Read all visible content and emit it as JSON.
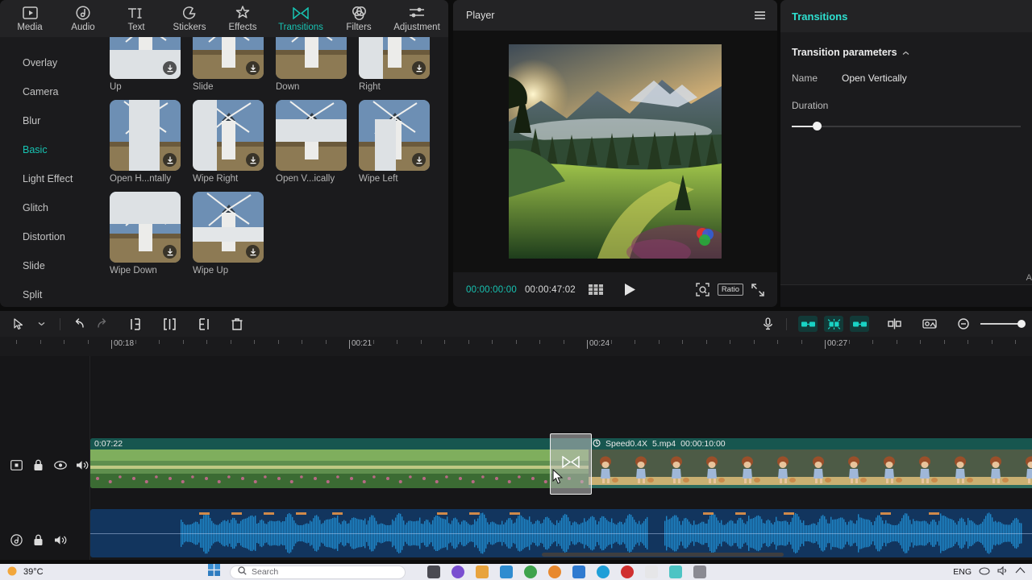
{
  "library": {
    "tabs": [
      {
        "label": "Media",
        "icon": "media-icon",
        "active": false
      },
      {
        "label": "Audio",
        "icon": "audio-icon",
        "active": false
      },
      {
        "label": "Text",
        "icon": "text-icon",
        "active": false
      },
      {
        "label": "Stickers",
        "icon": "stickers-icon",
        "active": false
      },
      {
        "label": "Effects",
        "icon": "effects-icon",
        "active": false
      },
      {
        "label": "Transitions",
        "icon": "transitions-icon",
        "active": true
      },
      {
        "label": "Filters",
        "icon": "filters-icon",
        "active": false
      },
      {
        "label": "Adjustment",
        "icon": "adjustment-icon",
        "active": false
      }
    ],
    "categories": [
      {
        "label": "Overlay",
        "active": false
      },
      {
        "label": "Camera",
        "active": false
      },
      {
        "label": "Blur",
        "active": false
      },
      {
        "label": "Basic",
        "active": true
      },
      {
        "label": "Light Effect",
        "active": false
      },
      {
        "label": "Glitch",
        "active": false
      },
      {
        "label": "Distortion",
        "active": false
      },
      {
        "label": "Slide",
        "active": false
      },
      {
        "label": "Split",
        "active": false
      }
    ],
    "items": [
      {
        "label": "Up",
        "style": "up",
        "download": true
      },
      {
        "label": "Slide",
        "style": "slide",
        "download": true
      },
      {
        "label": "Down",
        "style": "down",
        "download": false
      },
      {
        "label": "Right",
        "style": "right",
        "download": true
      },
      {
        "label": "Open H...ntally",
        "style": "openh",
        "download": true
      },
      {
        "label": "Wipe Right",
        "style": "wiper",
        "download": true
      },
      {
        "label": "Open V...ically",
        "style": "openv",
        "download": false
      },
      {
        "label": "Wipe Left",
        "style": "wipel",
        "download": true
      },
      {
        "label": "Wipe Down",
        "style": "wiped",
        "download": true
      },
      {
        "label": "Wipe Up",
        "style": "wipeu",
        "download": true
      }
    ]
  },
  "player": {
    "title": "Player",
    "menu_icon": "hamburger-icon",
    "current_time": "00:00:00:00",
    "total_time": "00:00:47:02",
    "frames_icon": "frames-icon",
    "play_icon": "play-icon",
    "snapshot_icon": "snapshot-icon",
    "ratio_label": "Ratio",
    "fullscreen_icon": "fullscreen-icon",
    "color_wheel_icon": "color-wheel-icon"
  },
  "inspector": {
    "title": "Transitions",
    "section_title": "Transition parameters",
    "collapse_icon": "chevron-up-icon",
    "name_label": "Name",
    "name_value": "Open Vertically",
    "duration_label": "Duration",
    "duration_percent": 9
  },
  "timeline": {
    "toolbar_left": [
      {
        "name": "select-tool",
        "icon": "cursor-icon"
      },
      {
        "name": "tool-dropdown",
        "icon": "chevron-down-icon"
      },
      {
        "name": "undo-button",
        "icon": "undo-icon"
      },
      {
        "name": "redo-button",
        "icon": "redo-icon"
      },
      {
        "name": "split-left-button",
        "icon": "trim-left-icon"
      },
      {
        "name": "split-button",
        "icon": "split-icon"
      },
      {
        "name": "split-right-button",
        "icon": "trim-right-icon"
      },
      {
        "name": "delete-button",
        "icon": "trash-icon"
      }
    ],
    "toolbar_right": [
      {
        "name": "record-voiceover-button",
        "icon": "microphone-icon",
        "highlight": false
      },
      {
        "name": "add-transition-left-button",
        "icon": "transition-left-icon",
        "highlight": true
      },
      {
        "name": "add-transition-center-button",
        "icon": "transition-center-icon",
        "highlight": true
      },
      {
        "name": "add-transition-right-button",
        "icon": "transition-right-icon",
        "highlight": true
      },
      {
        "name": "marker-button",
        "icon": "marker-icon",
        "highlight": false
      },
      {
        "name": "crop-button",
        "icon": "crop-icon",
        "highlight": false
      },
      {
        "name": "zoom-out-button",
        "icon": "zoom-out-icon",
        "highlight": false
      }
    ],
    "ruler_marks": [
      "00:18",
      "00:21",
      "00:24",
      "00:27"
    ],
    "video_track": {
      "head_icons": [
        "video-track-icon",
        "lock-icon",
        "eye-icon",
        "mute-icon"
      ],
      "left_clip_label": "0:07:22",
      "right_clip": {
        "speed_icon": "speed-icon",
        "speed": "Speed0.4X",
        "filename": "5.mp4",
        "duration": "00:00:10:00"
      },
      "transition_icon": "bowtie-transition-icon"
    },
    "audio_track": {
      "head_icons": [
        "audio-track-icon",
        "lock-icon",
        "mute-icon"
      ]
    }
  },
  "taskbar": {
    "weather_temp": "39°C",
    "weather_icon": "sun-icon",
    "start_icon": "windows-icon",
    "search_placeholder": "Search",
    "search_icon": "search-icon",
    "language": "ENG",
    "tray_icons": [
      "cloud-icon",
      "volume-icon",
      "network-icon"
    ]
  }
}
